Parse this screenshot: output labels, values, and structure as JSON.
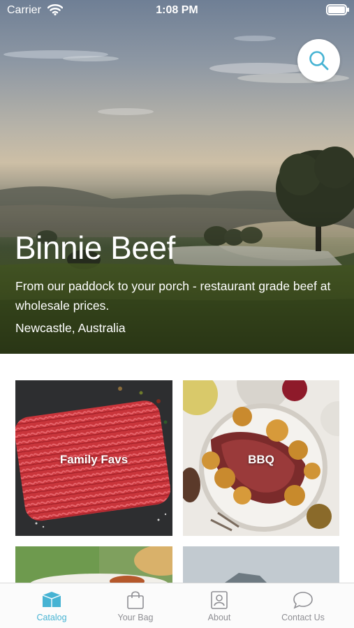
{
  "status_bar": {
    "carrier": "Carrier",
    "time": "1:08 PM"
  },
  "hero": {
    "title": "Binnie Beef",
    "tagline": "From our paddock to your porch - restaurant grade beef at wholesale prices.",
    "location": "Newcastle, Australia"
  },
  "categories": [
    {
      "label": "Family Favs",
      "image": "minced-beef-photo"
    },
    {
      "label": "BBQ",
      "image": "roast-beef-platter-photo"
    },
    {
      "label": "",
      "image": "food-photo"
    },
    {
      "label": "",
      "image": "food-photo"
    }
  ],
  "tab_bar": {
    "items": [
      {
        "label": "Catalog",
        "icon": "catalog-box-icon",
        "active": true
      },
      {
        "label": "Your Bag",
        "icon": "shopping-bag-icon",
        "active": false
      },
      {
        "label": "About",
        "icon": "person-card-icon",
        "active": false
      },
      {
        "label": "Contact Us",
        "icon": "chat-bubble-icon",
        "active": false
      }
    ]
  },
  "colors": {
    "accent": "#46b3d3",
    "inactive": "#8e8e93"
  }
}
